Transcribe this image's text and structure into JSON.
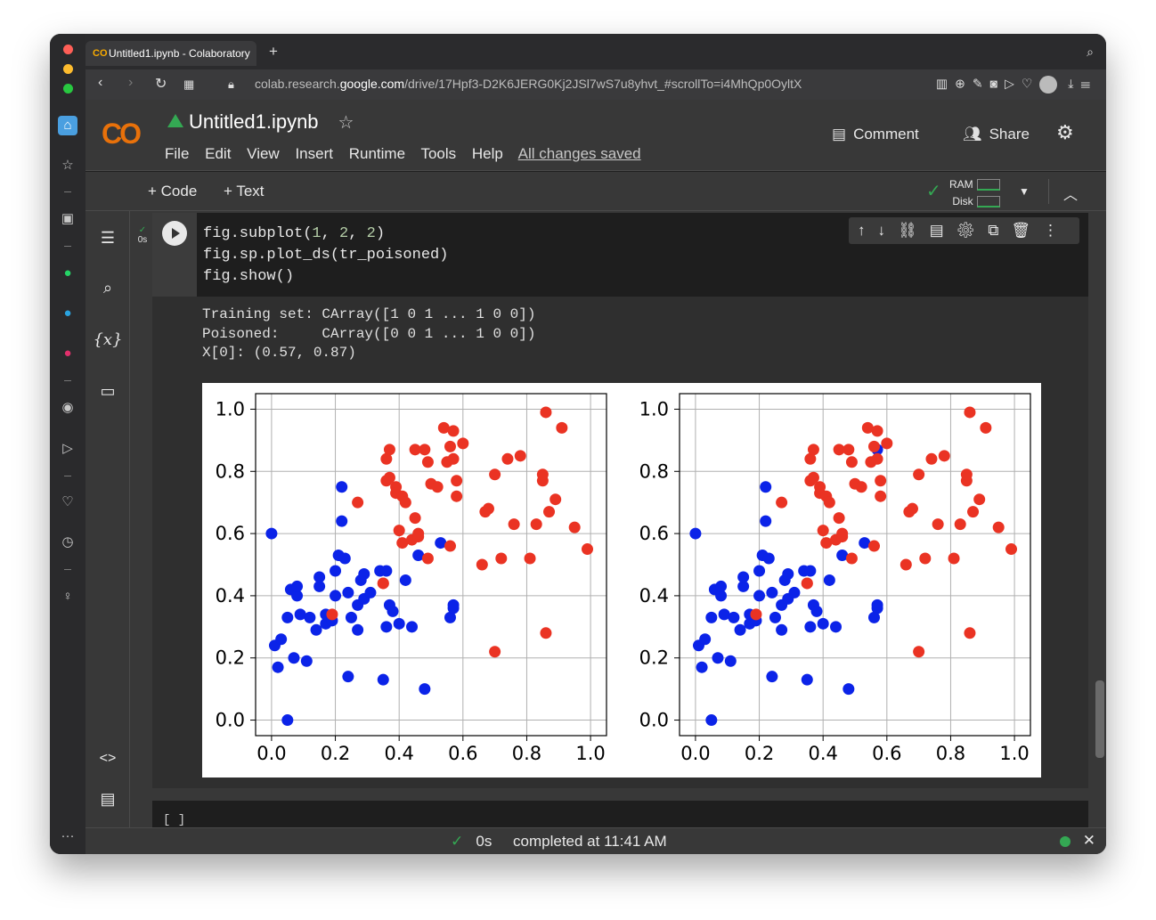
{
  "browser": {
    "tab_title": "Untitled1.ipynb - Colaboratory",
    "tab_logo": "CO",
    "new_tab": "+",
    "url_prefix": "colab.research.",
    "url_domain": "google.com",
    "url_path": "/drive/17Hpf3-D2K6JERG0Kj2JSl7wS7u8yhvt_#scrollTo=i4MhQp0OyltX"
  },
  "header": {
    "logo": "CO",
    "notebook_title": "Untitled1.ipynb",
    "menu": [
      "File",
      "Edit",
      "View",
      "Insert",
      "Runtime",
      "Tools",
      "Help"
    ],
    "save_status": "All changes saved",
    "comment_label": "Comment",
    "share_label": "Share"
  },
  "toolbar": {
    "add_code": "+ Code",
    "add_text": "+ Text",
    "ram_label": "RAM",
    "disk_label": "Disk"
  },
  "sidebar": {
    "icons": [
      "toc-icon",
      "search-icon",
      "variables-icon",
      "folder-icon",
      "code-snippets-icon",
      "command-palette-icon",
      "terminal-icon"
    ],
    "variables_symbol": "{x}"
  },
  "cell": {
    "exec_time": "0s",
    "code_lines": [
      {
        "fn": "fig.subplot(",
        "args": [
          {
            "n": "1"
          },
          {
            "t": ", "
          },
          {
            "n": "2"
          },
          {
            "t": ", "
          },
          {
            "n": "2"
          }
        ],
        "end": ")"
      },
      {
        "text": "fig.sp.plot_ds(tr_poisoned)"
      },
      {
        "text": "fig.show()"
      }
    ],
    "output_lines": [
      "Training set: CArray([1 0 1 ... 1 0 0])",
      "Poisoned:     CArray([0 0 1 ... 1 0 0])",
      "X[0]: (0.57, 0.87)"
    ],
    "next_cell_prompt": "[ ]"
  },
  "status": {
    "duration": "0s",
    "message": "completed at 11:41 AM"
  },
  "colors": {
    "blue": "#0b23e8",
    "red": "#ea3323",
    "accent_green": "#34a853",
    "colab_orange": "#f9ab00"
  },
  "chart_data": [
    {
      "type": "scatter",
      "title": "",
      "xlabel": "",
      "ylabel": "",
      "xlim": [
        -0.05,
        1.05
      ],
      "ylim": [
        -0.05,
        1.05
      ],
      "xticks": [
        "0.0",
        "0.2",
        "0.4",
        "0.6",
        "0.8",
        "1.0"
      ],
      "yticks": [
        "0.0",
        "0.2",
        "0.4",
        "0.6",
        "0.8",
        "1.0"
      ],
      "grid": true,
      "series": [
        {
          "color": "#0b23e8",
          "points": [
            [
              0.0,
              0.6
            ],
            [
              0.01,
              0.24
            ],
            [
              0.02,
              0.17
            ],
            [
              0.03,
              0.26
            ],
            [
              0.05,
              0.0
            ],
            [
              0.05,
              0.33
            ],
            [
              0.06,
              0.42
            ],
            [
              0.07,
              0.2
            ],
            [
              0.08,
              0.4
            ],
            [
              0.08,
              0.43
            ],
            [
              0.09,
              0.34
            ],
            [
              0.11,
              0.19
            ],
            [
              0.12,
              0.33
            ],
            [
              0.14,
              0.29
            ],
            [
              0.15,
              0.43
            ],
            [
              0.15,
              0.46
            ],
            [
              0.17,
              0.31
            ],
            [
              0.17,
              0.34
            ],
            [
              0.19,
              0.32
            ],
            [
              0.2,
              0.48
            ],
            [
              0.2,
              0.4
            ],
            [
              0.21,
              0.53
            ],
            [
              0.22,
              0.64
            ],
            [
              0.22,
              0.75
            ],
            [
              0.23,
              0.52
            ],
            [
              0.24,
              0.41
            ],
            [
              0.24,
              0.14
            ],
            [
              0.25,
              0.33
            ],
            [
              0.27,
              0.29
            ],
            [
              0.27,
              0.37
            ],
            [
              0.28,
              0.45
            ],
            [
              0.29,
              0.47
            ],
            [
              0.29,
              0.39
            ],
            [
              0.31,
              0.41
            ],
            [
              0.34,
              0.48
            ],
            [
              0.35,
              0.13
            ],
            [
              0.36,
              0.48
            ],
            [
              0.36,
              0.3
            ],
            [
              0.37,
              0.37
            ],
            [
              0.38,
              0.35
            ],
            [
              0.4,
              0.31
            ],
            [
              0.42,
              0.45
            ],
            [
              0.44,
              0.3
            ],
            [
              0.46,
              0.53
            ],
            [
              0.48,
              0.1
            ],
            [
              0.53,
              0.57
            ],
            [
              0.56,
              0.33
            ],
            [
              0.57,
              0.36
            ],
            [
              0.57,
              0.37
            ]
          ]
        },
        {
          "color": "#ea3323",
          "points": [
            [
              0.19,
              0.34
            ],
            [
              0.27,
              0.7
            ],
            [
              0.35,
              0.44
            ],
            [
              0.35,
              0.44
            ],
            [
              0.36,
              0.77
            ],
            [
              0.36,
              0.84
            ],
            [
              0.37,
              0.87
            ],
            [
              0.37,
              0.78
            ],
            [
              0.39,
              0.73
            ],
            [
              0.39,
              0.75
            ],
            [
              0.4,
              0.61
            ],
            [
              0.41,
              0.72
            ],
            [
              0.41,
              0.57
            ],
            [
              0.42,
              0.7
            ],
            [
              0.44,
              0.58
            ],
            [
              0.45,
              0.87
            ],
            [
              0.45,
              0.65
            ],
            [
              0.46,
              0.59
            ],
            [
              0.46,
              0.6
            ],
            [
              0.48,
              0.87
            ],
            [
              0.49,
              0.83
            ],
            [
              0.49,
              0.52
            ],
            [
              0.5,
              0.76
            ],
            [
              0.52,
              0.75
            ],
            [
              0.54,
              0.94
            ],
            [
              0.55,
              0.83
            ],
            [
              0.56,
              0.88
            ],
            [
              0.56,
              0.56
            ],
            [
              0.57,
              0.84
            ],
            [
              0.57,
              0.93
            ],
            [
              0.58,
              0.77
            ],
            [
              0.58,
              0.72
            ],
            [
              0.6,
              0.89
            ],
            [
              0.66,
              0.5
            ],
            [
              0.67,
              0.67
            ],
            [
              0.68,
              0.68
            ],
            [
              0.7,
              0.22
            ],
            [
              0.7,
              0.79
            ],
            [
              0.72,
              0.52
            ],
            [
              0.74,
              0.84
            ],
            [
              0.76,
              0.63
            ],
            [
              0.78,
              0.85
            ],
            [
              0.81,
              0.52
            ],
            [
              0.83,
              0.63
            ],
            [
              0.85,
              0.77
            ],
            [
              0.85,
              0.79
            ],
            [
              0.86,
              0.28
            ],
            [
              0.86,
              0.99
            ],
            [
              0.87,
              0.67
            ],
            [
              0.89,
              0.71
            ],
            [
              0.91,
              0.94
            ],
            [
              0.95,
              0.62
            ],
            [
              0.99,
              0.55
            ]
          ]
        }
      ]
    },
    {
      "type": "scatter",
      "title": "",
      "xlabel": "",
      "ylabel": "",
      "xlim": [
        -0.05,
        1.05
      ],
      "ylim": [
        -0.05,
        1.05
      ],
      "xticks": [
        "0.0",
        "0.2",
        "0.4",
        "0.6",
        "0.8",
        "1.0"
      ],
      "yticks": [
        "0.0",
        "0.2",
        "0.4",
        "0.6",
        "0.8",
        "1.0"
      ],
      "grid": true,
      "series": [
        {
          "color": "#0b23e8",
          "points": [
            [
              0.0,
              0.6
            ],
            [
              0.01,
              0.24
            ],
            [
              0.02,
              0.17
            ],
            [
              0.03,
              0.26
            ],
            [
              0.05,
              0.0
            ],
            [
              0.05,
              0.33
            ],
            [
              0.06,
              0.42
            ],
            [
              0.07,
              0.2
            ],
            [
              0.08,
              0.4
            ],
            [
              0.08,
              0.43
            ],
            [
              0.09,
              0.34
            ],
            [
              0.11,
              0.19
            ],
            [
              0.12,
              0.33
            ],
            [
              0.14,
              0.29
            ],
            [
              0.15,
              0.43
            ],
            [
              0.15,
              0.46
            ],
            [
              0.17,
              0.31
            ],
            [
              0.17,
              0.34
            ],
            [
              0.19,
              0.32
            ],
            [
              0.2,
              0.48
            ],
            [
              0.2,
              0.4
            ],
            [
              0.21,
              0.53
            ],
            [
              0.22,
              0.64
            ],
            [
              0.22,
              0.75
            ],
            [
              0.23,
              0.52
            ],
            [
              0.24,
              0.41
            ],
            [
              0.24,
              0.14
            ],
            [
              0.25,
              0.33
            ],
            [
              0.27,
              0.29
            ],
            [
              0.27,
              0.37
            ],
            [
              0.28,
              0.45
            ],
            [
              0.29,
              0.47
            ],
            [
              0.29,
              0.39
            ],
            [
              0.31,
              0.41
            ],
            [
              0.34,
              0.48
            ],
            [
              0.35,
              0.13
            ],
            [
              0.36,
              0.48
            ],
            [
              0.36,
              0.3
            ],
            [
              0.37,
              0.37
            ],
            [
              0.38,
              0.35
            ],
            [
              0.4,
              0.31
            ],
            [
              0.42,
              0.45
            ],
            [
              0.44,
              0.3
            ],
            [
              0.46,
              0.53
            ],
            [
              0.48,
              0.1
            ],
            [
              0.53,
              0.57
            ],
            [
              0.56,
              0.33
            ],
            [
              0.57,
              0.36
            ],
            [
              0.57,
              0.37
            ],
            [
              0.57,
              0.87
            ]
          ]
        },
        {
          "color": "#ea3323",
          "points": [
            [
              0.19,
              0.34
            ],
            [
              0.27,
              0.7
            ],
            [
              0.35,
              0.44
            ],
            [
              0.35,
              0.44
            ],
            [
              0.36,
              0.77
            ],
            [
              0.36,
              0.84
            ],
            [
              0.37,
              0.87
            ],
            [
              0.37,
              0.78
            ],
            [
              0.39,
              0.73
            ],
            [
              0.39,
              0.75
            ],
            [
              0.4,
              0.61
            ],
            [
              0.41,
              0.72
            ],
            [
              0.41,
              0.57
            ],
            [
              0.42,
              0.7
            ],
            [
              0.44,
              0.58
            ],
            [
              0.45,
              0.87
            ],
            [
              0.45,
              0.65
            ],
            [
              0.46,
              0.59
            ],
            [
              0.46,
              0.6
            ],
            [
              0.48,
              0.87
            ],
            [
              0.49,
              0.83
            ],
            [
              0.49,
              0.52
            ],
            [
              0.5,
              0.76
            ],
            [
              0.52,
              0.75
            ],
            [
              0.54,
              0.94
            ],
            [
              0.55,
              0.83
            ],
            [
              0.56,
              0.88
            ],
            [
              0.56,
              0.56
            ],
            [
              0.57,
              0.84
            ],
            [
              0.57,
              0.93
            ],
            [
              0.58,
              0.77
            ],
            [
              0.58,
              0.72
            ],
            [
              0.6,
              0.89
            ],
            [
              0.66,
              0.5
            ],
            [
              0.67,
              0.67
            ],
            [
              0.68,
              0.68
            ],
            [
              0.7,
              0.22
            ],
            [
              0.7,
              0.79
            ],
            [
              0.72,
              0.52
            ],
            [
              0.74,
              0.84
            ],
            [
              0.76,
              0.63
            ],
            [
              0.78,
              0.85
            ],
            [
              0.81,
              0.52
            ],
            [
              0.83,
              0.63
            ],
            [
              0.85,
              0.77
            ],
            [
              0.85,
              0.79
            ],
            [
              0.86,
              0.28
            ],
            [
              0.86,
              0.99
            ],
            [
              0.87,
              0.67
            ],
            [
              0.89,
              0.71
            ],
            [
              0.91,
              0.94
            ],
            [
              0.95,
              0.62
            ],
            [
              0.99,
              0.55
            ]
          ]
        }
      ]
    }
  ]
}
